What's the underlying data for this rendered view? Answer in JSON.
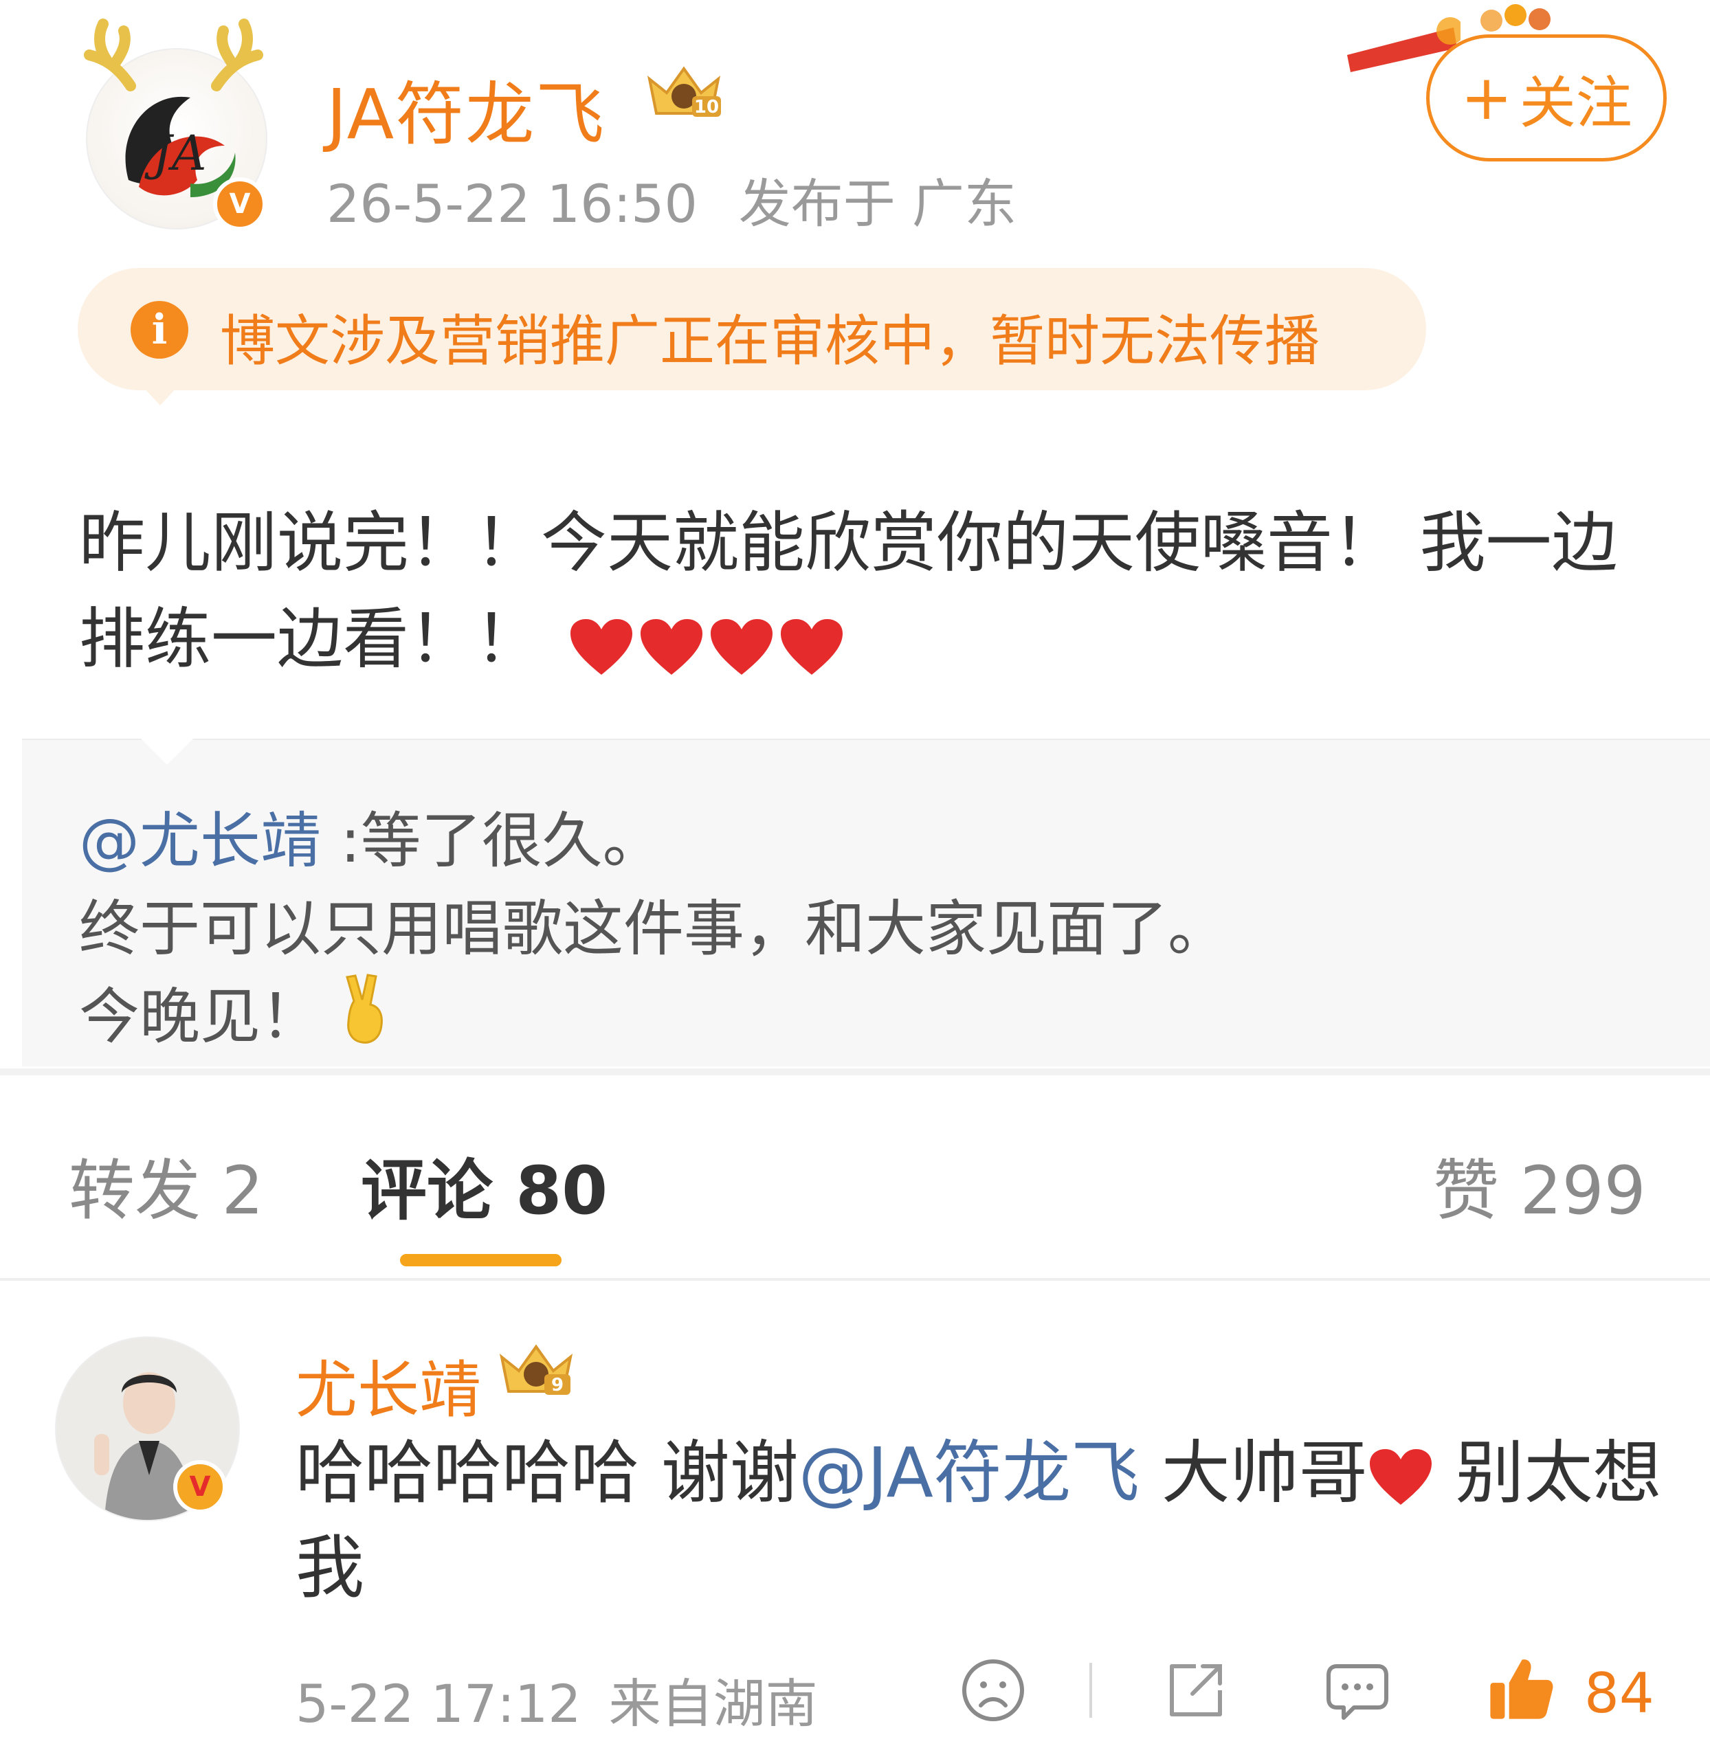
{
  "post": {
    "author": "JA符龙飞",
    "author_level_badge": "10",
    "verified_mark": "V",
    "time": "26-5-22 16:50",
    "location": "发布于 广东",
    "follow_label": "关注",
    "follow_plus": "+",
    "notice": "博文涉及营销推广正在审核中，暂时无法传播",
    "text": "昨儿刚说完！！今天就能欣赏你的天使嗓音！ 我一边排练一边看！！",
    "text_emojis": [
      "heart",
      "heart",
      "heart",
      "heart"
    ],
    "repost": {
      "mention": "@尤长靖",
      "line1": " :等了很久。",
      "line2": "终于可以只用唱歌这件事，和大家见面了。",
      "line3": "今晚见！"
    }
  },
  "tabs": {
    "repost": "转发 2",
    "comment": "评论 80",
    "like": "赞 299"
  },
  "comment": {
    "author": "尤长靖",
    "author_level_badge": "9",
    "verified_mark": "V",
    "text_before": "哈哈哈哈哈 谢谢",
    "mention": "@JA符龙飞",
    "text_middle": " 大帅哥",
    "text_after": " 别太想我",
    "time": "5-22 17:12",
    "source": "来自湖南",
    "like_count": "84"
  },
  "colors": {
    "accent": "#f58b1f",
    "username": "#f07c1a",
    "mention": "#4a6fa5",
    "notice_bg": "#fdf1e4"
  },
  "icons": [
    "info-icon",
    "heart-icon",
    "victory-hand-icon",
    "sad-face-icon",
    "share-icon",
    "comment-icon",
    "thumbs-up-icon",
    "crown-icon"
  ]
}
